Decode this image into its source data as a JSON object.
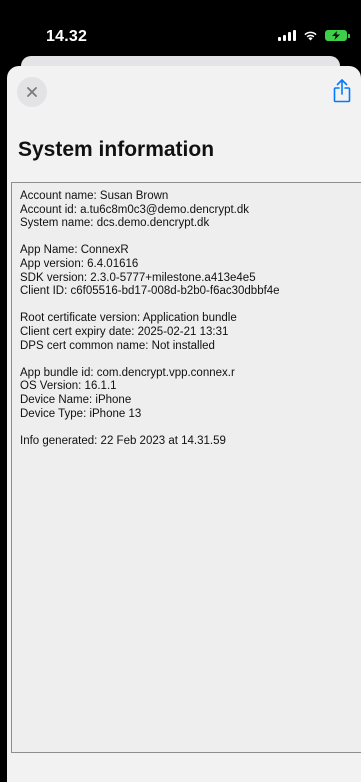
{
  "status_bar": {
    "time": "14.32"
  },
  "icons": {
    "close": "close-icon",
    "share": "share-icon",
    "signal": "cellular-signal-icon",
    "wifi": "wifi-icon",
    "battery": "battery-charging-icon"
  },
  "colors": {
    "battery": "#3ecf4a",
    "share_icon": "#007aff",
    "sheet_background": "#f2f2f2"
  },
  "page": {
    "title": "System information"
  },
  "info": {
    "account": [
      "Account name: Susan Brown",
      "Account id: a.tu6c8m0c3@demo.dencrypt.dk",
      "System name: dcs.demo.dencrypt.dk"
    ],
    "app": [
      "App Name: ConnexR",
      "App version: 6.4.01616",
      "SDK version: 2.3.0-5777+milestone.a413e4e5",
      "Client ID: c6f05516-bd17-008d-b2b0-f6ac30dbbf4e"
    ],
    "certificates": [
      "Root certificate version: Application bundle",
      "Client cert expiry date: 2025-02-21 13:31",
      "DPS cert common name: Not installed"
    ],
    "device": [
      "App bundle id: com.dencrypt.vpp.connex.r",
      "OS Version: 16.1.1",
      "Device Name: iPhone",
      "Device Type: iPhone 13"
    ],
    "generated": [
      "Info generated: 22 Feb 2023 at 14.31.59"
    ]
  }
}
